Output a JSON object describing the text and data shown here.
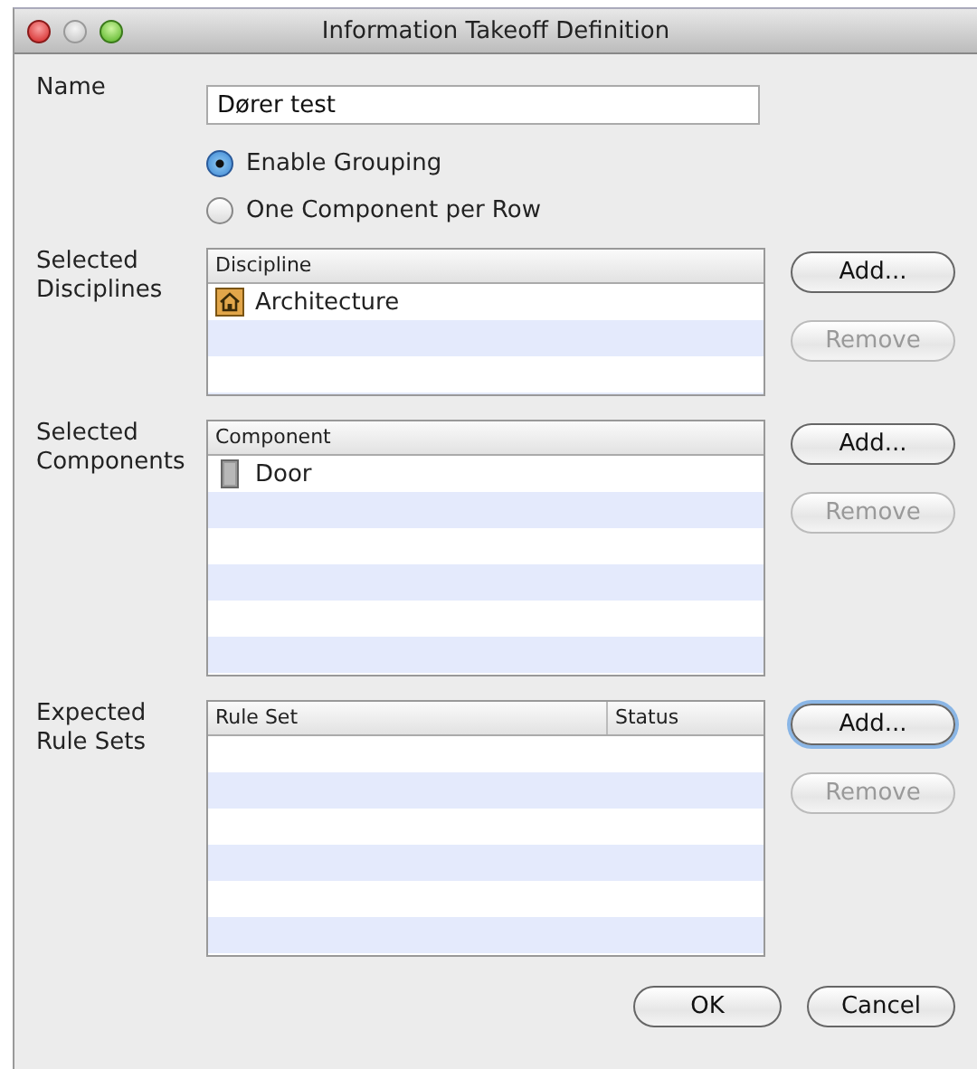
{
  "window": {
    "title": "Information Takeoff Definition"
  },
  "name_field": {
    "label": "Name",
    "value": "Dører test"
  },
  "grouping": [
    {
      "label": "Enable Grouping",
      "selected": true
    },
    {
      "label": "One Component per Row",
      "selected": false
    }
  ],
  "sections": [
    {
      "label": "Selected Disciplines",
      "columns": [
        "Discipline"
      ],
      "rows": [
        {
          "kind": "house",
          "text": "Architecture"
        }
      ],
      "buttons": [
        {
          "label": "Add...",
          "disabled": false,
          "focused": false
        },
        {
          "label": "Remove",
          "disabled": true,
          "focused": false
        }
      ]
    },
    {
      "label": "Selected Components",
      "columns": [
        "Component"
      ],
      "rows": [
        {
          "kind": "door",
          "text": "Door"
        }
      ],
      "buttons": [
        {
          "label": "Add...",
          "disabled": false,
          "focused": false
        },
        {
          "label": "Remove",
          "disabled": true,
          "focused": false
        }
      ]
    },
    {
      "label": "Expected Rule Sets",
      "columns": [
        "Rule Set",
        "Status"
      ],
      "buttons": [
        {
          "label": "Add...",
          "disabled": false,
          "focused": true
        },
        {
          "label": "Remove",
          "disabled": true,
          "focused": false
        }
      ]
    }
  ],
  "footer_buttons": [
    "OK",
    "Cancel"
  ]
}
